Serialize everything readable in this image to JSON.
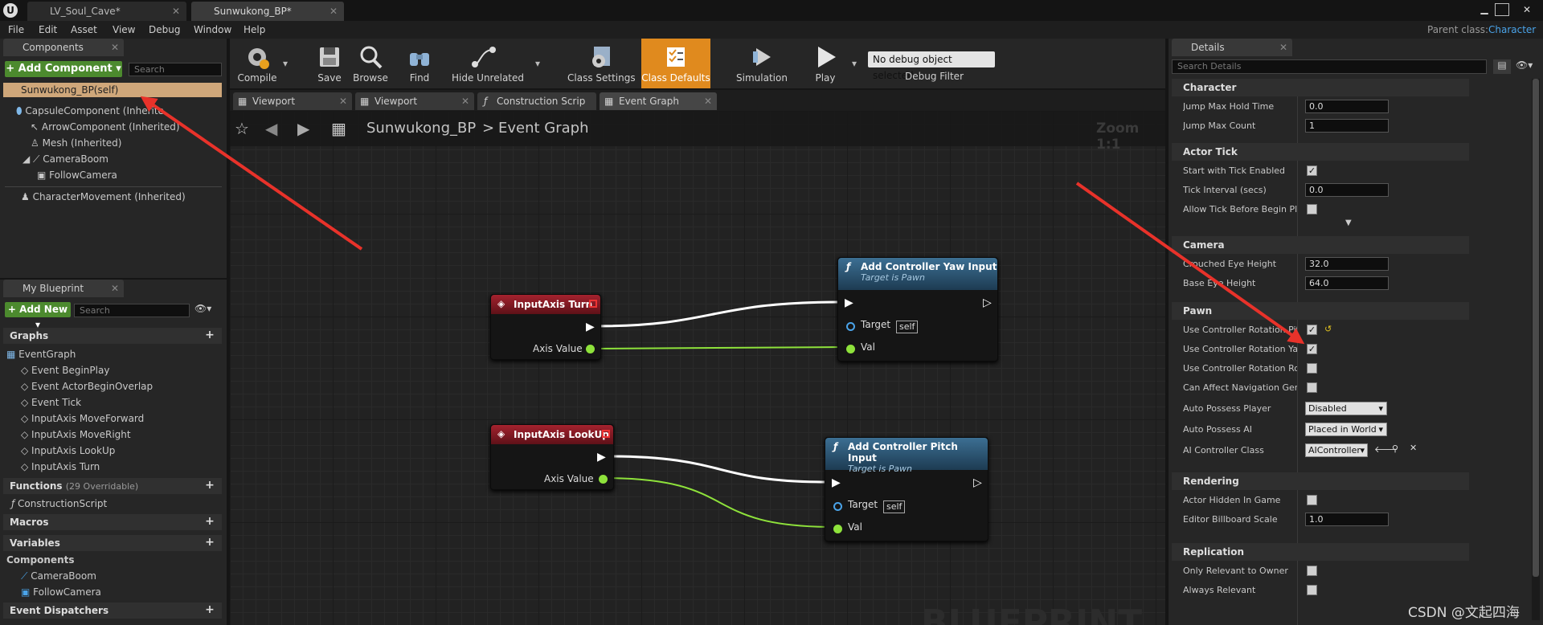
{
  "window": {
    "tabs": [
      {
        "label": "LV_Soul_Cave*",
        "active": false
      },
      {
        "label": "Sunwukong_BP*",
        "active": true
      }
    ]
  },
  "menu": {
    "items": [
      "File",
      "Edit",
      "Asset",
      "View",
      "Debug",
      "Window",
      "Help"
    ],
    "parent_class_label": "Parent class:",
    "parent_class_value": "Character"
  },
  "components_panel": {
    "tab_label": "Components",
    "add_button": "+ Add Component ▾",
    "search_placeholder": "Search",
    "self_item": "Sunwukong_BP(self)",
    "tree": [
      "CapsuleComponent (Inherite",
      "ArrowComponent (Inherited)",
      "Mesh (Inherited)",
      "CameraBoom",
      "FollowCamera",
      "CharacterMovement (Inherited)"
    ]
  },
  "my_blueprint": {
    "tab_label": "My Blueprint",
    "add_button": "+ Add New ▾",
    "search_placeholder": "Search",
    "graphs_header": "Graphs",
    "event_graph": "EventGraph",
    "events": [
      "Event BeginPlay",
      "Event ActorBeginOverlap",
      "Event Tick",
      "InputAxis MoveForward",
      "InputAxis MoveRight",
      "InputAxis LookUp",
      "InputAxis Turn"
    ],
    "functions_header": "Functions",
    "functions_count": "(29 Overridable)",
    "construction_script": "ConstructionScript",
    "macros_header": "Macros",
    "variables_header": "Variables",
    "components_header": "Components",
    "variable_components": [
      "CameraBoom",
      "FollowCamera"
    ],
    "dispatchers_header": "Event Dispatchers"
  },
  "toolbar": {
    "compile": "Compile",
    "save": "Save",
    "browse": "Browse",
    "find": "Find",
    "hide_unrelated": "Hide Unrelated",
    "class_settings": "Class Settings",
    "class_defaults": "Class Defaults",
    "simulation": "Simulation",
    "play": "Play",
    "debug_object": "No debug object selected ▾",
    "debug_filter": "Debug Filter"
  },
  "editor_tabs": [
    {
      "label": "Viewport"
    },
    {
      "label": "Viewport"
    },
    {
      "label": "Construction Scrip"
    },
    {
      "label": "Event Graph"
    }
  ],
  "graph": {
    "breadcrumb_bp": "Sunwukong_BP",
    "breadcrumb_sep": ">",
    "breadcrumb_graph": "Event Graph",
    "zoom": "Zoom 1:1",
    "watermark": "BLUEPRINT",
    "node_turn": {
      "title": "InputAxis Turn",
      "pin": "Axis Value"
    },
    "node_lookup": {
      "title": "InputAxis LookUp",
      "pin": "Axis Value"
    },
    "node_yaw": {
      "title": "Add Controller Yaw Input",
      "subtitle": "Target is Pawn",
      "target": "Target",
      "self": "self",
      "val": "Val"
    },
    "node_pitch": {
      "title": "Add Controller Pitch Input",
      "subtitle": "Target is Pawn",
      "target": "Target",
      "self": "self",
      "val": "Val"
    }
  },
  "details": {
    "tab_label": "Details",
    "search_placeholder": "Search Details",
    "character": {
      "header": "Character",
      "jump_hold_label": "Jump Max Hold Time",
      "jump_hold_value": "0.0",
      "jump_count_label": "Jump Max Count",
      "jump_count_value": "1"
    },
    "actor_tick": {
      "header": "Actor Tick",
      "start_label": "Start with Tick Enabled",
      "interval_label": "Tick Interval (secs)",
      "interval_value": "0.0",
      "allow_label": "Allow Tick Before Begin Pla"
    },
    "camera": {
      "header": "Camera",
      "crouched_label": "Crouched Eye Height",
      "crouched_value": "32.0",
      "base_label": "Base Eye Height",
      "base_value": "64.0"
    },
    "pawn": {
      "header": "Pawn",
      "pitch_label": "Use Controller Rotation Pitc",
      "yaw_label": "Use Controller Rotation Yaw",
      "roll_label": "Use Controller Rotation Roll",
      "nav_label": "Can Affect Navigation Gene",
      "auto_player_label": "Auto Possess Player",
      "auto_player_value": "Disabled",
      "auto_ai_label": "Auto Possess AI",
      "auto_ai_value": "Placed in World",
      "ai_class_label": "AI Controller Class",
      "ai_class_value": "AIController"
    },
    "rendering": {
      "header": "Rendering",
      "hidden_label": "Actor Hidden In Game",
      "billboard_label": "Editor Billboard Scale",
      "billboard_value": "1.0"
    },
    "replication": {
      "header": "Replication",
      "owner_label": "Only Relevant to Owner",
      "always_label": "Always Relevant"
    }
  },
  "watermark": "CSDN @文起四海",
  "colors": {
    "accent_orange": "#e08a1e",
    "exec_white": "#ffffff",
    "float_green": "#8ee23b",
    "annotation_red": "#e8322a"
  }
}
